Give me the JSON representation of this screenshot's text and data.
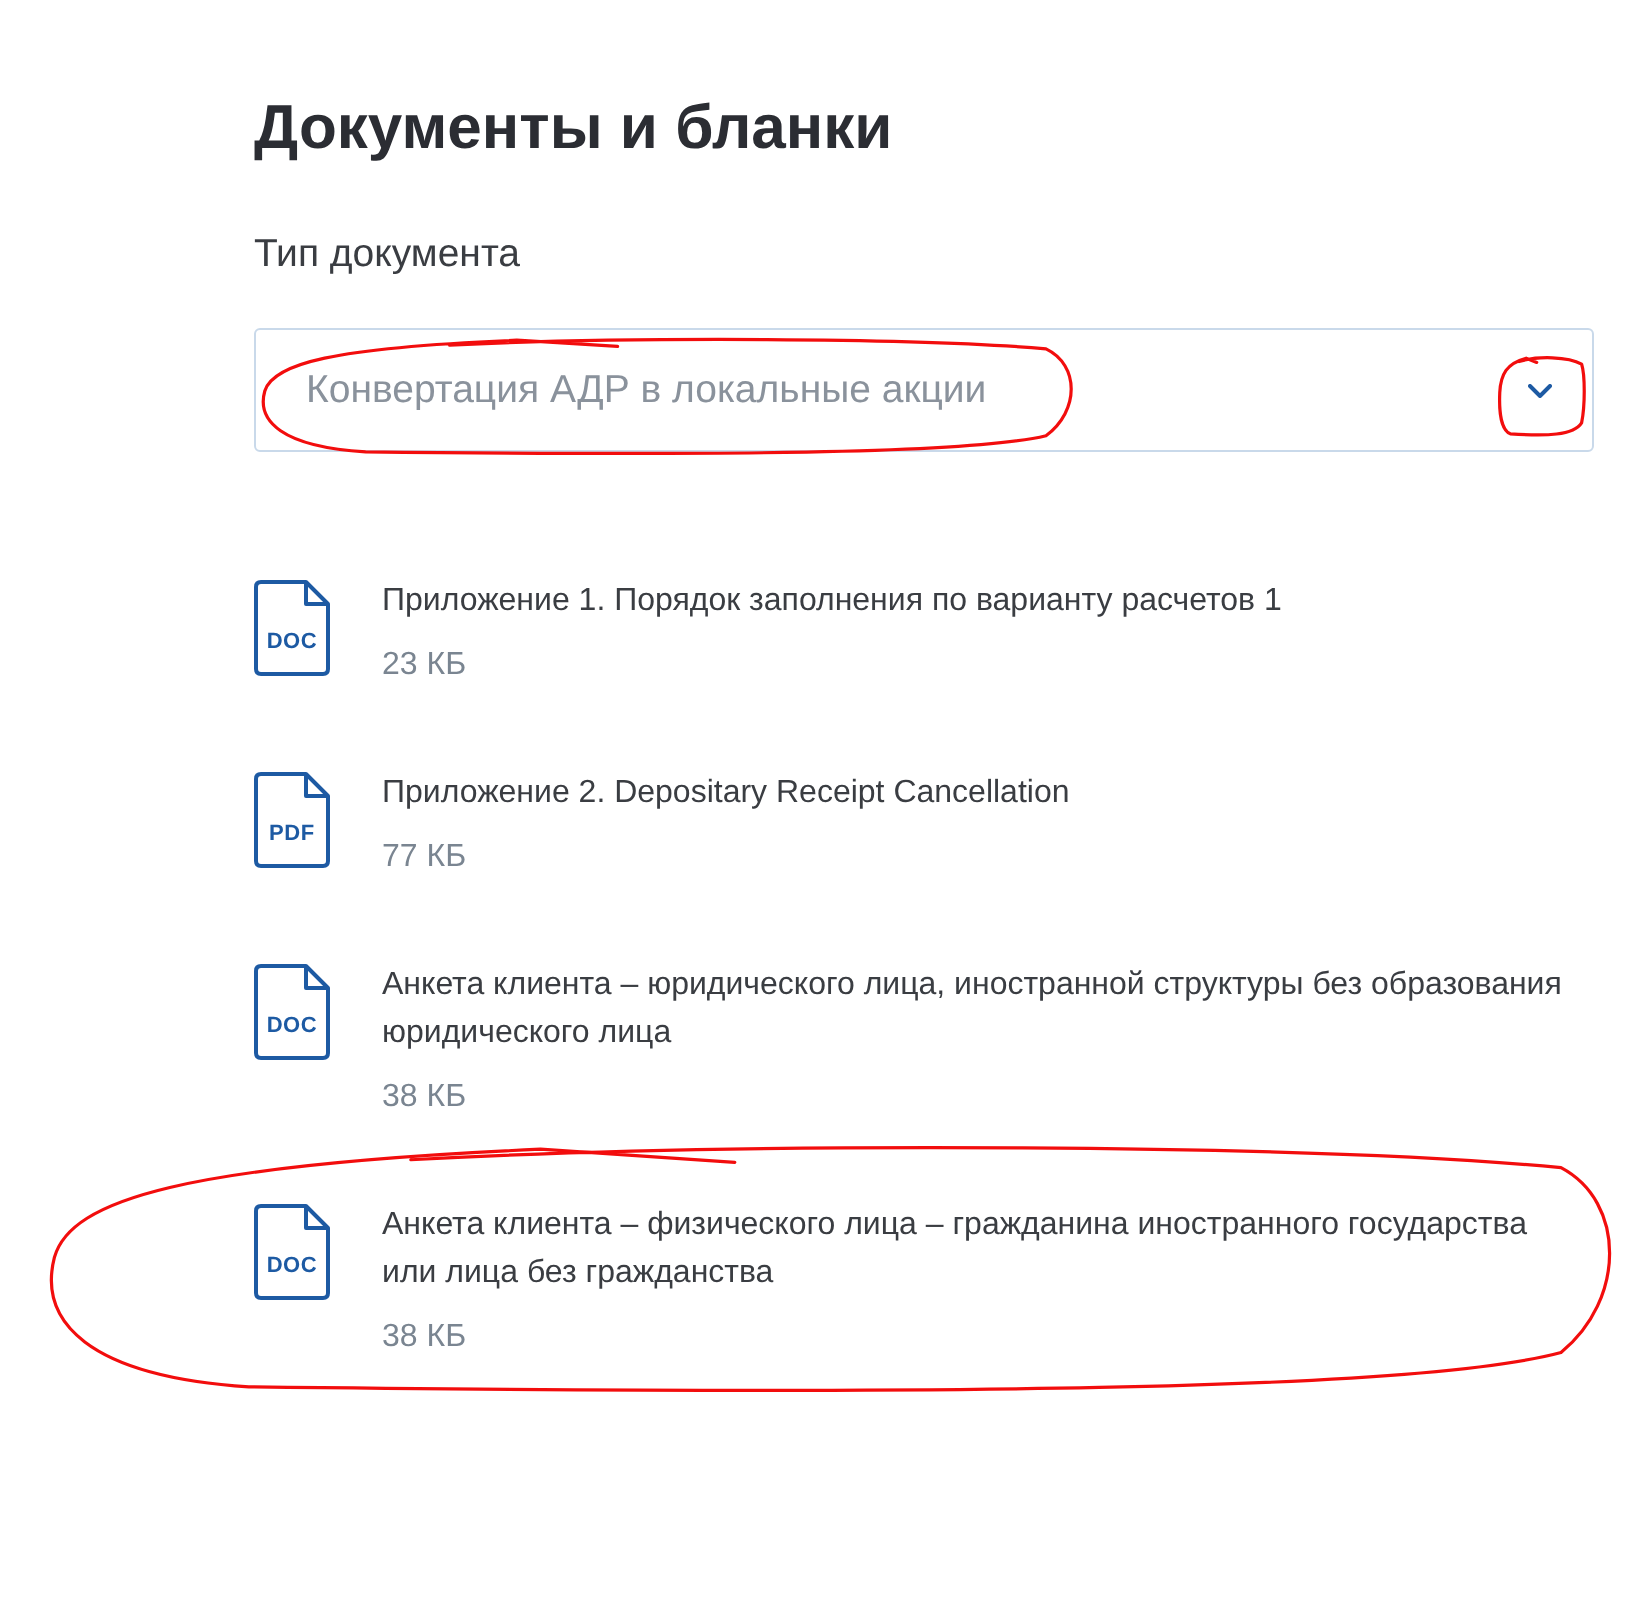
{
  "page": {
    "title": "Документы и бланки"
  },
  "filter": {
    "label": "Тип документа",
    "value": "Конвертация АДР в локальные акции",
    "value_circled": true,
    "toggle_circled": true
  },
  "documents": [
    {
      "title": "Приложение 1. Порядок заполнения по варианту расчетов 1",
      "format": "DOC",
      "size": "23 КБ",
      "circled": false
    },
    {
      "title": "Приложение 2. Depositary Receipt Cancellation",
      "format": "PDF",
      "size": "77 КБ",
      "circled": false
    },
    {
      "title": "Анкета клиента – юридического лица, иностранной структуры без образования юридического лица",
      "format": "DOC",
      "size": "38 КБ",
      "circled": false
    },
    {
      "title": "Анкета клиента – физического лица – гражданина иностранного государства или лица без гражданства",
      "format": "DOC",
      "size": "38 КБ",
      "circled": true
    }
  ]
}
